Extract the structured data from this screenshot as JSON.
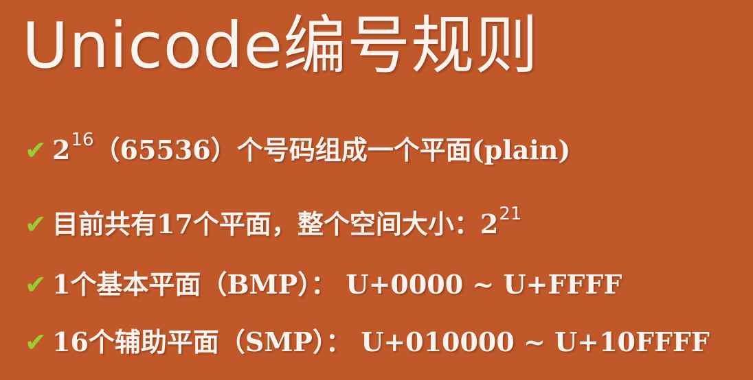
{
  "title": "Unicode编号规则",
  "bullets": [
    {
      "base": "2",
      "exponent": "16",
      "text": "（65536）个号码组成一个平面(plain)"
    },
    {
      "text": "目前共有17个平面，整个空间大小：2",
      "exponent": "21"
    },
    {
      "text": "1个基本平面（BMP）： U+0000 ~ U+FFFF"
    },
    {
      "text": "16个辅助平面（SMP）： U+010000 ~ U+10FFFF"
    }
  ],
  "colors": {
    "background": "#c0582a",
    "text": "#fbf4ee",
    "check": "#9acd32"
  },
  "icons": {
    "bullet": "check-icon"
  }
}
